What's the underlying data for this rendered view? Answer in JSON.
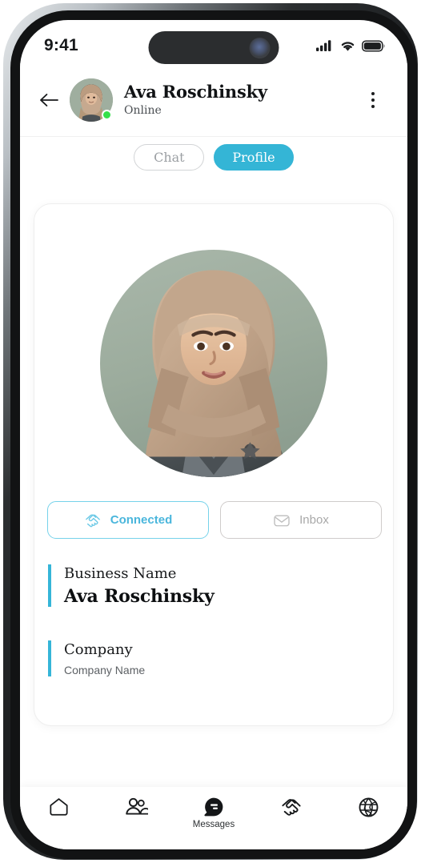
{
  "status_bar": {
    "time": "9:41",
    "icons": [
      "cellular-signal-icon",
      "wifi-icon",
      "battery-icon"
    ]
  },
  "header": {
    "back_icon": "back-arrow-icon",
    "avatar_alt": "Ava Roschinsky avatar",
    "name": "Ava Roschinsky",
    "status": "Online",
    "online_indicator_color": "#35e04a",
    "menu_icon": "kebab-menu-icon"
  },
  "tabs": [
    {
      "label": "Chat",
      "active": false
    },
    {
      "label": "Profile",
      "active": true
    }
  ],
  "profile": {
    "avatar_alt": "Ava Roschinsky profile photo",
    "actions": [
      {
        "label": "Connected",
        "icon": "handshake-icon",
        "state": "active"
      },
      {
        "label": "Inbox",
        "icon": "envelope-icon",
        "state": "default"
      }
    ],
    "fields": [
      {
        "label": "Business Name",
        "value": "Ava Roschinsky",
        "emphasis": "strong"
      },
      {
        "label": "Company",
        "value": "Company Name",
        "emphasis": "sub"
      }
    ]
  },
  "bottom_nav": [
    {
      "icon": "home-icon",
      "label": "",
      "active": false
    },
    {
      "icon": "contacts-icon",
      "label": "",
      "active": false
    },
    {
      "icon": "messages-icon",
      "label": "Messages",
      "active": true
    },
    {
      "icon": "handshake-icon",
      "label": "",
      "active": false
    },
    {
      "icon": "globe-icon",
      "label": "",
      "active": false
    }
  ],
  "colors": {
    "accent": "#34b5d6",
    "accent_border": "#76d2ea",
    "online": "#35e04a",
    "text_primary": "#111315",
    "text_muted": "#9ca0a4"
  }
}
